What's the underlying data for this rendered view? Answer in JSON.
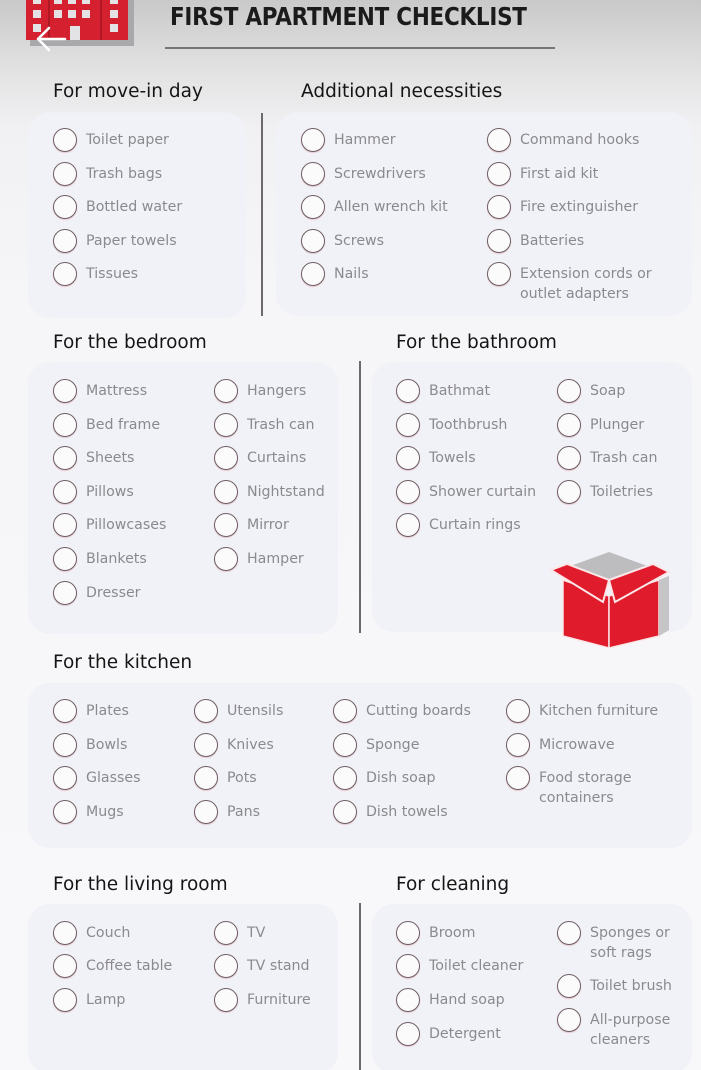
{
  "header": {
    "title": "FIRST APARTMENT CHECKLIST",
    "logo_icon": "apartment-building-icon",
    "back_icon": "back-arrow-icon",
    "accent_color": "#d4202f"
  },
  "sections": {
    "move_in": {
      "heading": "For move-in day",
      "items": [
        "Toilet paper",
        "Trash bags",
        "Bottled water",
        "Paper towels",
        "Tissues"
      ]
    },
    "additional": {
      "heading": "Additional necessities",
      "items": [
        "Hammer",
        "Screwdrivers",
        "Allen wrench kit",
        "Screws",
        "Nails",
        "Command hooks",
        "First aid kit",
        "Fire extinguisher",
        "Batteries",
        "Extension cords or",
        "outlet adapters"
      ]
    },
    "bedroom": {
      "heading": "For the bedroom",
      "items": [
        "Mattress",
        "Bed frame",
        "Sheets",
        "Pillows",
        "Pillowcases",
        "Blankets",
        "Dresser",
        "Hangers",
        "Trash can",
        "Curtains",
        "Nightstand",
        "Mirror",
        "Hamper"
      ]
    },
    "bathroom": {
      "heading": "For the bathroom",
      "items": [
        "Bathmat",
        "Toothbrush",
        "Towels",
        "Shower curtain",
        "Curtain rings",
        "Soap",
        "Plunger",
        "Trash can",
        "Toiletries"
      ]
    },
    "kitchen": {
      "heading": "For the kitchen",
      "items": [
        "Plates",
        "Bowls",
        "Glasses",
        "Mugs",
        "Utensils",
        "Knives",
        "Pots",
        "Pans",
        "Cutting boards",
        "Sponge",
        "Dish soap",
        "Dish towels",
        "Kitchen furniture",
        "Microwave",
        "Food storage",
        "containers"
      ]
    },
    "living": {
      "heading": "For the living room",
      "items": [
        "Couch",
        "Coffee table",
        "Lamp",
        "TV",
        "TV stand",
        "Furniture"
      ]
    },
    "cleaning": {
      "heading": "For cleaning",
      "items": [
        "Broom",
        "Toilet cleaner",
        "Hand soap",
        "Detergent",
        "Sponges or",
        "soft rags",
        "Toilet brush",
        "All-purpose",
        "cleaners"
      ]
    }
  },
  "illustration": {
    "icon": "open-box-icon",
    "color": "#e01b2b"
  }
}
